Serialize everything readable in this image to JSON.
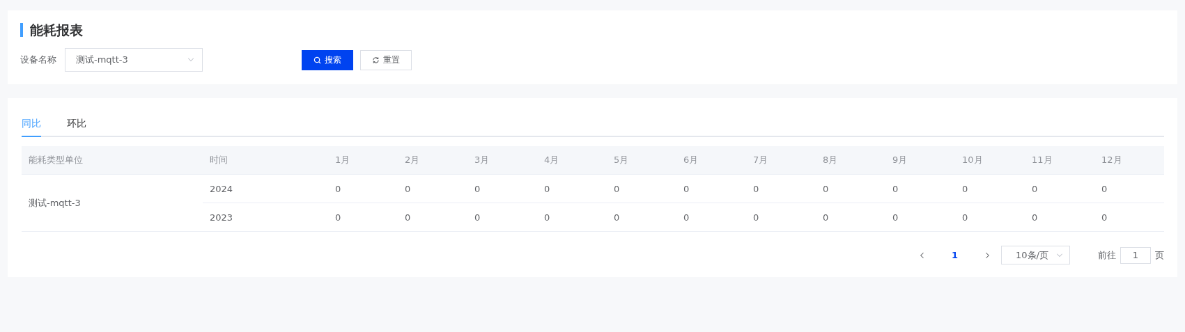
{
  "title": "能耗报表",
  "filter": {
    "label": "设备名称",
    "value": "测试-mqtt-3"
  },
  "buttons": [
    {
      "kind": "primary",
      "label": "搜索"
    },
    {
      "kind": "default",
      "label": "重置"
    }
  ],
  "tabs": [
    {
      "label": "同比",
      "selected": true
    },
    {
      "label": "环比",
      "selected": false
    }
  ],
  "table": {
    "columns": [
      "能耗类型单位",
      "时间",
      "1月",
      "2月",
      "3月",
      "4月",
      "5月",
      "6月",
      "7月",
      "8月",
      "9月",
      "10月",
      "11月",
      "12月"
    ],
    "groups": [
      {
        "name": "测试-mqtt-3",
        "rows": [
          {
            "time": "2024",
            "values": [
              "0",
              "0",
              "0",
              "0",
              "0",
              "0",
              "0",
              "0",
              "0",
              "0",
              "0",
              "0"
            ]
          },
          {
            "time": "2023",
            "values": [
              "0",
              "0",
              "0",
              "0",
              "0",
              "0",
              "0",
              "0",
              "0",
              "0",
              "0",
              "0"
            ]
          }
        ]
      }
    ]
  },
  "pagination": {
    "pages": [
      {
        "label": "1",
        "selected": true
      }
    ],
    "page_size": "10条/页",
    "goto_label": "前往",
    "goto_value": "1",
    "page_suffix": "页"
  }
}
